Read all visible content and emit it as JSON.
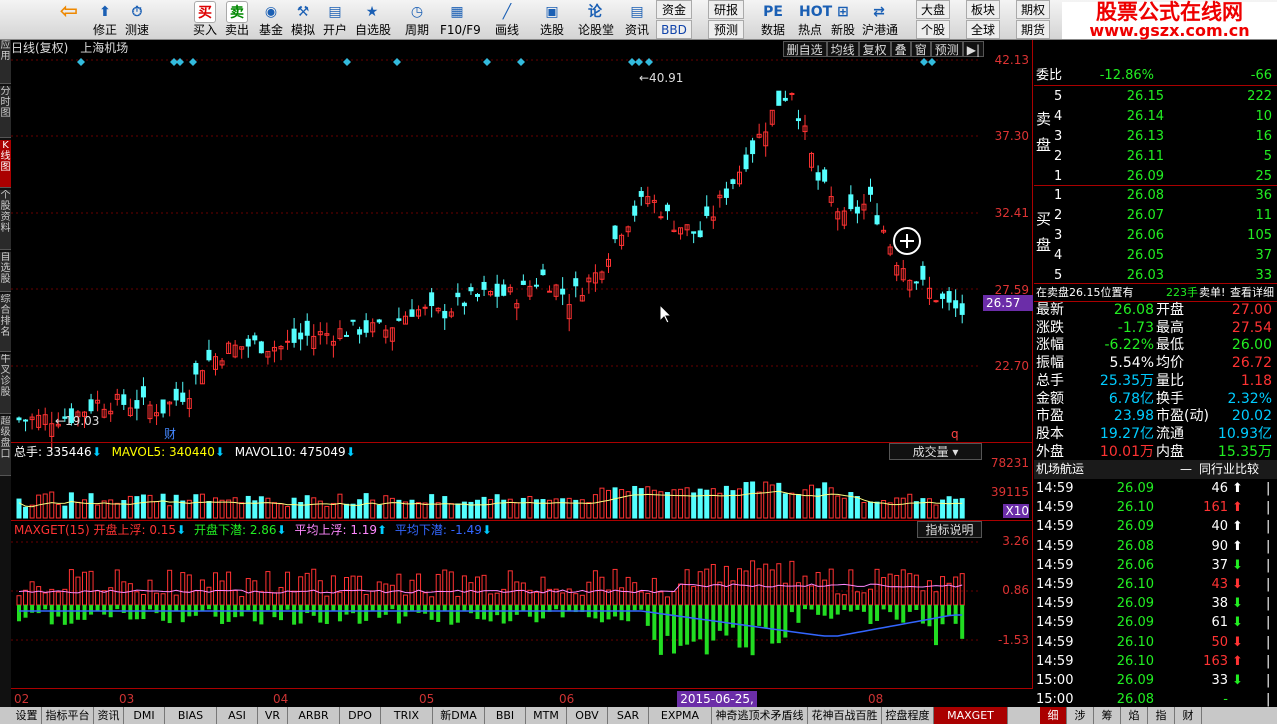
{
  "toolbar": {
    "items": [
      {
        "name": "back",
        "label": ""
      },
      {
        "name": "revise",
        "label": "修正"
      },
      {
        "name": "test",
        "label": "测速"
      },
      {
        "name": "buy",
        "label": "买入",
        "icon": "买"
      },
      {
        "name": "sell",
        "label": "卖出",
        "icon": "卖"
      },
      {
        "name": "fund",
        "label": "基金"
      },
      {
        "name": "simulate",
        "label": "模拟"
      },
      {
        "name": "open-account",
        "label": "开户"
      },
      {
        "name": "watchlist",
        "label": "自选股"
      },
      {
        "name": "period",
        "label": "周期"
      },
      {
        "name": "f10",
        "label": "F10/F9"
      },
      {
        "name": "draw",
        "label": "画线"
      },
      {
        "name": "stock-pick",
        "label": "选股"
      },
      {
        "name": "forum",
        "label": "论股堂",
        "icon": "论"
      },
      {
        "name": "info",
        "label": "资讯"
      },
      {
        "name": "data",
        "label": "数据"
      },
      {
        "name": "hot",
        "label": "热点"
      },
      {
        "name": "new-stock",
        "label": "新股"
      },
      {
        "name": "hk-connect",
        "label": "沪港通"
      }
    ],
    "small": [
      "资金",
      "BBD",
      "研报",
      "预测",
      "大盘",
      "个股",
      "板块",
      "全球",
      "期权",
      "期货"
    ]
  },
  "watermark": {
    "line1": "股票公式在线网",
    "line2": "www.gszx.com.cn"
  },
  "left_tabs": [
    "应用",
    "分时图",
    "K线图",
    "个股资料",
    "自选股",
    "综合排名",
    "牛叉诊股",
    "超级盘口"
  ],
  "kline": {
    "title": "日线(复权)",
    "stock": "上海机场",
    "buttons": [
      "删自选",
      "均线",
      "复权",
      "叠",
      "窗",
      "预测"
    ],
    "yticks": [
      "42.13",
      "37.30",
      "32.41",
      "27.59",
      "22.70"
    ],
    "current_price": "26.57",
    "high_label": "40.91",
    "low_label": "19.03",
    "caicon": "财",
    "qicon": "q"
  },
  "volume": {
    "total_label": "总手:",
    "total": "335446",
    "mavol5_label": "MAVOL5:",
    "mavol5": "340440",
    "mavol10_label": "MAVOL10:",
    "mavol10": "475049",
    "dropdown": "成交量",
    "yticks": [
      "78231",
      "39115"
    ],
    "unit": "X10"
  },
  "maxget": {
    "name": "MAXGET(15)",
    "f1_label": "开盘上浮:",
    "f1": "0.15",
    "f2_label": "开盘下潜:",
    "f2": "2.86",
    "f3_label": "平均上浮:",
    "f3": "1.19",
    "f4_label": "平均下潜:",
    "f4": "-1.49",
    "help": "指标说明",
    "yticks": [
      "3.26",
      "0.86",
      "-1.53"
    ]
  },
  "xaxis": {
    "labels": [
      "02",
      "03",
      "04",
      "05",
      "06",
      "07",
      "08"
    ],
    "selected": "2015-06-25,四"
  },
  "bottom_tabs": [
    "设置",
    "指标平台",
    "资讯",
    "DMI",
    "BIAS",
    "ASI",
    "VR",
    "ARBR",
    "DPO",
    "TRIX",
    "新DMA",
    "BBI",
    "MTM",
    "OBV",
    "SAR",
    "EXPMA",
    "神奇逃顶术矛盾线",
    "花神百战百胜",
    "控盘程度",
    "MAXGET"
  ],
  "bottom_right": [
    "细",
    "涉",
    "筹",
    "焰",
    "指",
    "财"
  ],
  "quote": {
    "weibi_label": "委比",
    "weibi": "-12.86%",
    "weicha": "-66",
    "sell_label": [
      "卖",
      "盘"
    ],
    "buy_label": [
      "买",
      "盘"
    ],
    "sell": [
      {
        "lvl": "5",
        "price": "26.15",
        "vol": "222"
      },
      {
        "lvl": "4",
        "price": "26.14",
        "vol": "10"
      },
      {
        "lvl": "3",
        "price": "26.13",
        "vol": "16"
      },
      {
        "lvl": "2",
        "price": "26.11",
        "vol": "5"
      },
      {
        "lvl": "1",
        "price": "26.09",
        "vol": "25"
      }
    ],
    "buy": [
      {
        "lvl": "1",
        "price": "26.08",
        "vol": "36"
      },
      {
        "lvl": "2",
        "price": "26.07",
        "vol": "11"
      },
      {
        "lvl": "3",
        "price": "26.06",
        "vol": "105"
      },
      {
        "lvl": "4",
        "price": "26.05",
        "vol": "37"
      },
      {
        "lvl": "5",
        "price": "26.03",
        "vol": "33"
      }
    ],
    "notice": "在卖盘26.15位置有",
    "notice_vol": "223手",
    "notice_kind": "卖单!",
    "notice_link": "查看详细",
    "stats": [
      [
        "最新",
        "26.08",
        "开盘",
        "27.00"
      ],
      [
        "涨跌",
        "-1.73",
        "最高",
        "27.54"
      ],
      [
        "涨幅",
        "-6.22%",
        "最低",
        "26.00"
      ],
      [
        "振幅",
        "5.54%",
        "均价",
        "26.72"
      ],
      [
        "总手",
        "25.35万",
        "量比",
        "1.18"
      ],
      [
        "金额",
        "6.78亿",
        "换手",
        "2.32%"
      ],
      [
        "市盈",
        "23.98",
        "市盈(动)",
        "20.02"
      ],
      [
        "股本",
        "19.27亿",
        "流通",
        "10.93亿"
      ],
      [
        "外盘",
        "10.01万",
        "内盘",
        "15.35万"
      ]
    ],
    "industry": "机场航运",
    "compare": "同行业比较",
    "ticks": [
      [
        "14:59",
        "26.09",
        "46",
        "up"
      ],
      [
        "14:59",
        "26.10",
        "161",
        "up-red"
      ],
      [
        "14:59",
        "26.09",
        "40",
        "up"
      ],
      [
        "14:59",
        "26.08",
        "90",
        "up"
      ],
      [
        "14:59",
        "26.06",
        "37",
        "down"
      ],
      [
        "14:59",
        "26.10",
        "43",
        "down-red"
      ],
      [
        "14:59",
        "26.09",
        "38",
        "down"
      ],
      [
        "14:59",
        "26.09",
        "61",
        "down"
      ],
      [
        "14:59",
        "26.10",
        "50",
        "down-red"
      ],
      [
        "14:59",
        "26.10",
        "163",
        "up-red"
      ],
      [
        "15:00",
        "26.09",
        "33",
        "down"
      ],
      [
        "15:00",
        "26.08",
        "-",
        "none"
      ]
    ]
  },
  "colors": {
    "up": "#ff3232",
    "down": "#54ffff",
    "bg": "#000000",
    "axis": "#aa0000",
    "ma": "#ffff80",
    "green": "#22dd22"
  }
}
